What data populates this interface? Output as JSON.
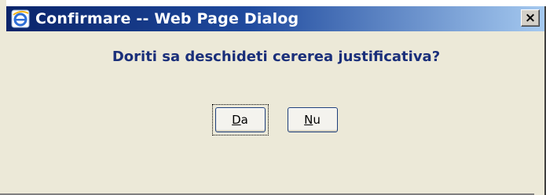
{
  "window": {
    "title": "Confirmare -- Web Page Dialog",
    "close_glyph": "×",
    "title_icon": "ie-icon"
  },
  "dialog": {
    "message": "Doriti sa deschideti cererea justificativa?",
    "buttons": [
      {
        "label_access": "D",
        "label_rest": "a",
        "focused": true
      },
      {
        "label_access": "N",
        "label_rest": "u",
        "focused": false
      }
    ]
  },
  "colors": {
    "title_start": "#0a246a",
    "title_end": "#a6caf0",
    "message": "#1a2f7a",
    "background": "#ece9d8"
  }
}
